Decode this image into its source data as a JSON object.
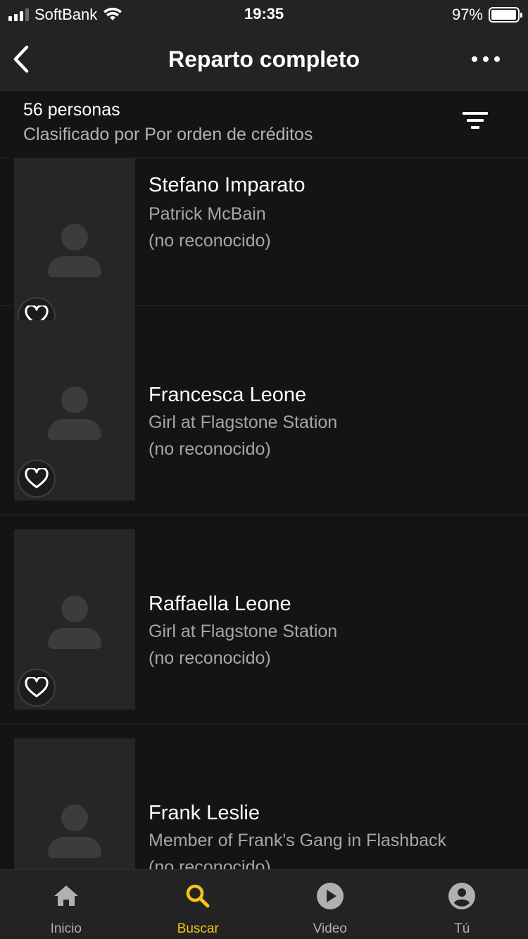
{
  "status_bar": {
    "carrier": "SoftBank",
    "time": "19:35",
    "battery": "97%",
    "battery_level": 0.97
  },
  "nav": {
    "title": "Reparto completo"
  },
  "sort": {
    "count": "56 personas",
    "label": "Clasificado por Por orden de créditos"
  },
  "cast": [
    {
      "name": "Stefano Imparato",
      "role": "Patrick McBain",
      "note": "(no reconocido)"
    },
    {
      "name": "Francesca Leone",
      "role": "Girl at Flagstone Station",
      "note": "(no reconocido)"
    },
    {
      "name": "Raffaella Leone",
      "role": "Girl at Flagstone Station",
      "note": "(no reconocido)"
    },
    {
      "name": "Frank Leslie",
      "role": "Member of Frank's Gang in Flashback",
      "note": "(no reconocido)"
    }
  ],
  "tabs": [
    {
      "label": "Inicio",
      "icon": "home-icon"
    },
    {
      "label": "Buscar",
      "icon": "search-icon"
    },
    {
      "label": "Video",
      "icon": "play-icon"
    },
    {
      "label": "Tú",
      "icon": "profile-icon"
    }
  ],
  "colors": {
    "accent": "#f5c518",
    "background": "#141414",
    "bar": "#232323"
  }
}
